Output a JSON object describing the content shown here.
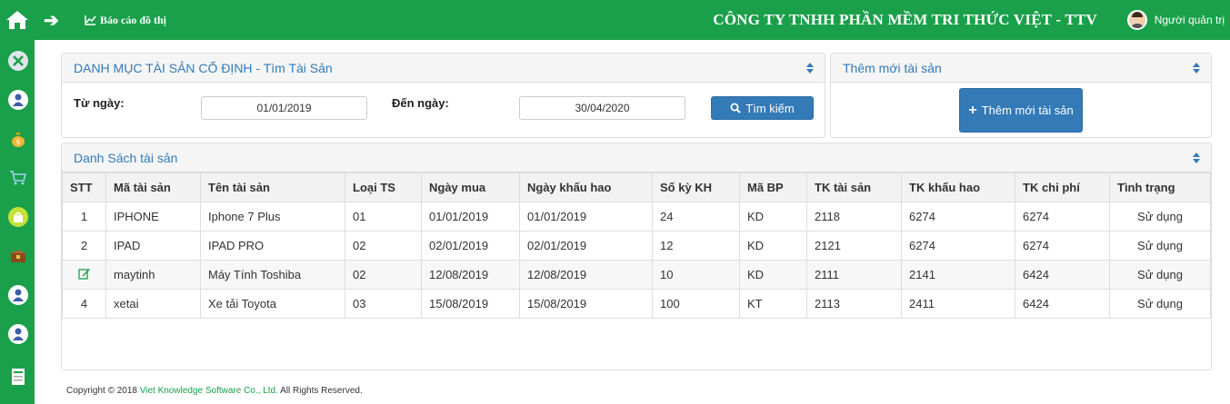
{
  "topbar": {
    "report_label": "Báo cáo đồ thị",
    "company": "CÔNG TY TNHH PHẦN MỀM TRI THỨC VIỆT - TTV",
    "user": "Người quản trị"
  },
  "colors": {
    "brand": "#1aa04a",
    "primary": "#337ab7"
  },
  "sidebar": {
    "icons": [
      "tools-icon",
      "user-icon",
      "money-bag-icon",
      "cart-icon",
      "shopping-bag-icon",
      "treasure-chest-icon",
      "user-icon",
      "user-icon",
      "tax-document-icon"
    ]
  },
  "search_panel": {
    "title": "DANH MỤC TÀI SẢN CỐ ĐỊNH - Tìm Tài Sản",
    "from_label": "Từ ngày:",
    "from_value": "01/01/2019",
    "to_label": "Đến ngày:",
    "to_value": "30/04/2020",
    "search_button": "Tìm kiếm"
  },
  "add_panel": {
    "title": "Thêm mới tài sản",
    "add_button": "Thêm mới tài sản"
  },
  "list_panel": {
    "title": "Danh Sách tài sản",
    "columns": [
      "STT",
      "Mã tài sản",
      "Tên tài sản",
      "Loại TS",
      "Ngày mua",
      "Ngày khấu hao",
      "Số kỳ KH",
      "Mã BP",
      "TK tài sản",
      "TK khấu hao",
      "TK chi phí",
      "Tình trạng"
    ],
    "rows": [
      {
        "stt": "1",
        "ma": "IPHONE",
        "ten": "Iphone 7 Plus",
        "loai": "01",
        "ngay_mua": "01/01/2019",
        "ngay_kh": "01/01/2019",
        "so_ky": "24",
        "ma_bp": "KD",
        "tk_ts": "2118",
        "tk_kh": "6274",
        "tk_cp": "6274",
        "tinh_trang": "Sử dụng"
      },
      {
        "stt": "2",
        "ma": "IPAD",
        "ten": "IPAD PRO",
        "loai": "02",
        "ngay_mua": "02/01/2019",
        "ngay_kh": "02/01/2019",
        "so_ky": "12",
        "ma_bp": "KD",
        "tk_ts": "2121",
        "tk_kh": "6274",
        "tk_cp": "6274",
        "tinh_trang": "Sử dụng"
      },
      {
        "stt": "",
        "ma": "maytinh",
        "ten": "Máy Tính Toshiba",
        "loai": "02",
        "ngay_mua": "12/08/2019",
        "ngay_kh": "12/08/2019",
        "so_ky": "10",
        "ma_bp": "KD",
        "tk_ts": "2111",
        "tk_kh": "2141",
        "tk_cp": "6424",
        "tinh_trang": "Sử dụng"
      },
      {
        "stt": "4",
        "ma": "xetai",
        "ten": "Xe tải Toyota",
        "loai": "03",
        "ngay_mua": "15/08/2019",
        "ngay_kh": "15/08/2019",
        "so_ky": "100",
        "ma_bp": "KT",
        "tk_ts": "2113",
        "tk_kh": "2411",
        "tk_cp": "6424",
        "tinh_trang": "Sử dụng"
      }
    ]
  },
  "footer": {
    "prefix": "Copyright © 2018",
    "company": "Viet Knowledge Software Co., Ltd.",
    "suffix": "All Rights Reserved."
  }
}
